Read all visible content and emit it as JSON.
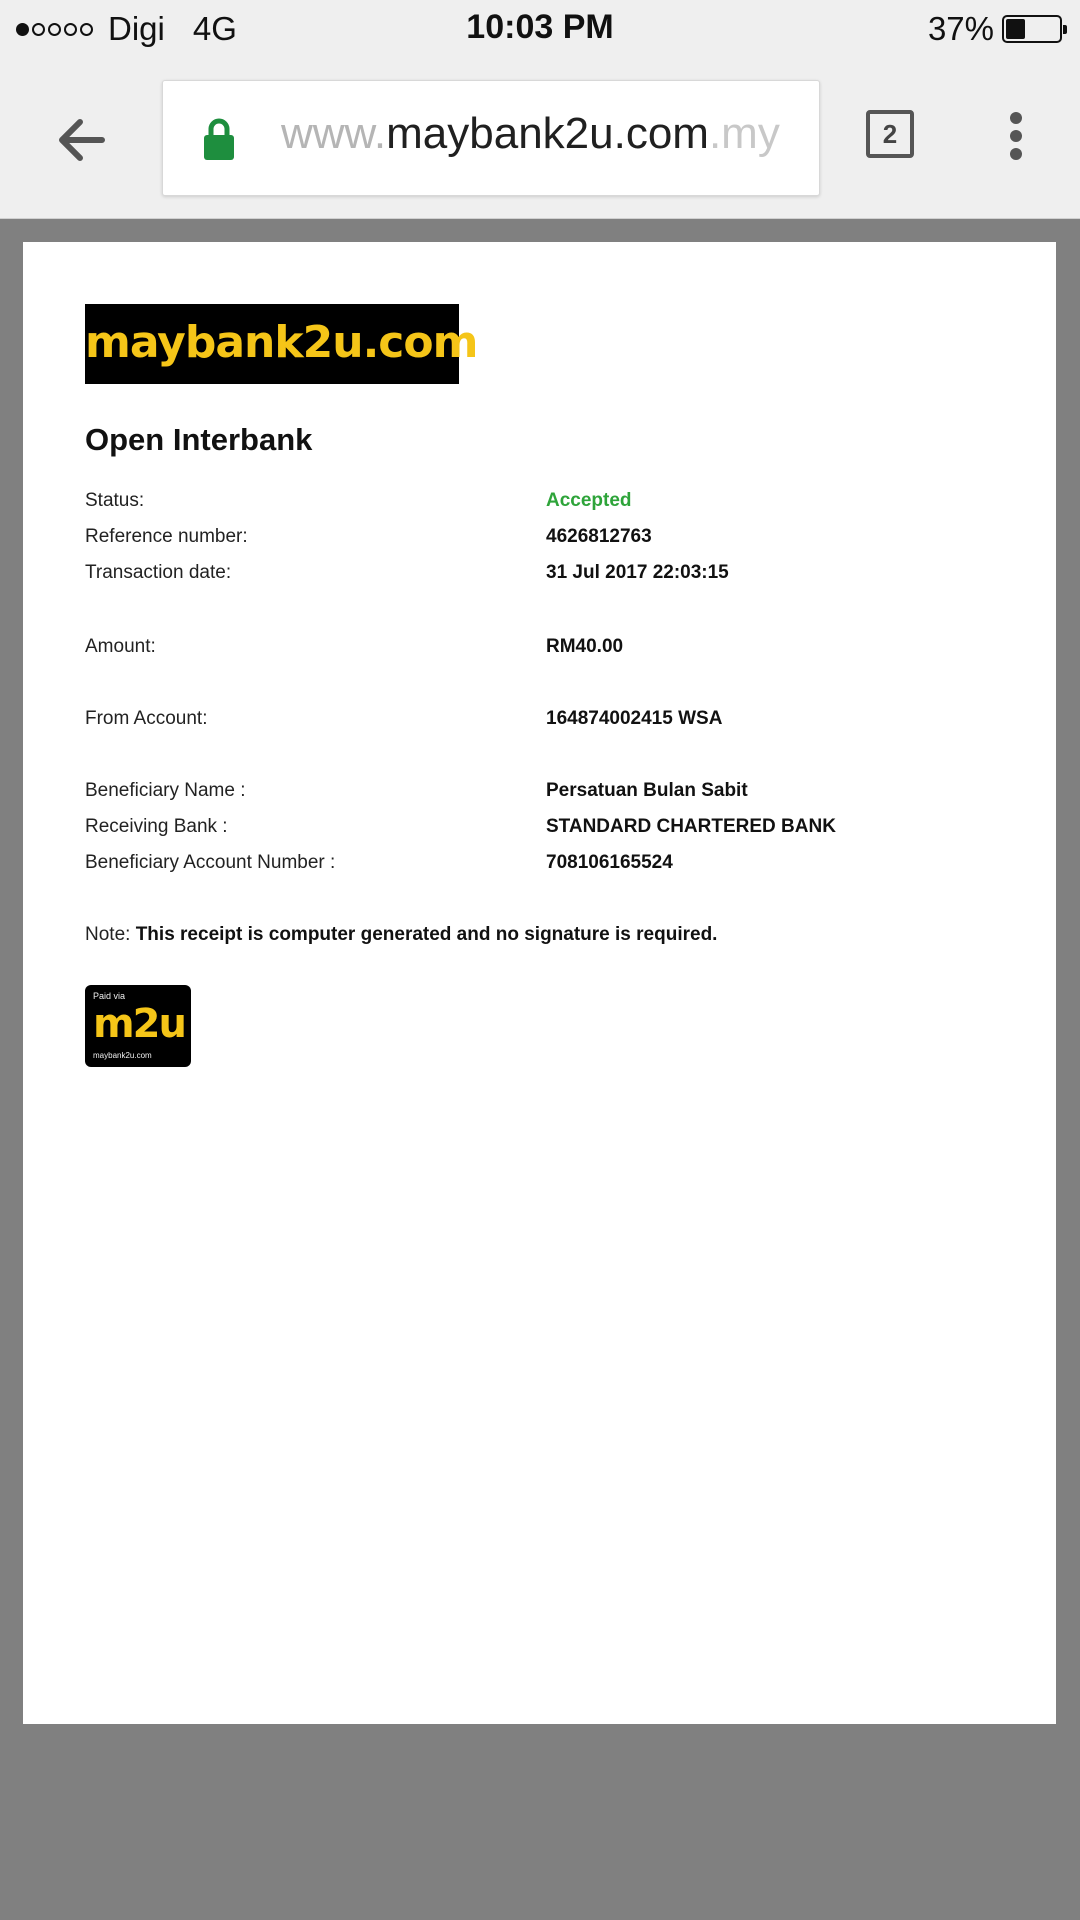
{
  "status_bar": {
    "carrier": "Digi",
    "network": "4G",
    "time": "10:03 PM",
    "battery": "37%",
    "battery_level": 0.37
  },
  "browser": {
    "url_prefix": "www.",
    "url_main": "maybank2u.com",
    "url_suffix": ".my",
    "tab_count": "2"
  },
  "receipt": {
    "logo": "maybank2u.com",
    "title": "Open Interbank",
    "fields": {
      "status_label": "Status:",
      "status_value": "Accepted",
      "reference_label": "Reference number:",
      "reference_value": "4626812763",
      "date_label": "Transaction date:",
      "date_value": "31 Jul 2017 22:03:15",
      "amount_label": "Amount:",
      "amount_value": "RM40.00",
      "from_label": "From Account:",
      "from_value": "164874002415 WSA",
      "beneficiary_label": "Beneficiary Name :",
      "beneficiary_value": "Persatuan Bulan Sabit",
      "bank_label": "Receiving Bank :",
      "bank_value": "STANDARD CHARTERED BANK",
      "account_label": "Beneficiary Account Number :",
      "account_value": "708106165524"
    },
    "note_prefix": "Note:",
    "note_text": "This receipt is computer generated and no signature is required.",
    "badge": {
      "paid_via": "Paid via",
      "brand": "m2u",
      "site": "maybank2u.com"
    }
  },
  "colors": {
    "accent_yellow": "#f5c518",
    "accepted_green": "#2ea43a",
    "lock_green": "#1e8e3e"
  }
}
